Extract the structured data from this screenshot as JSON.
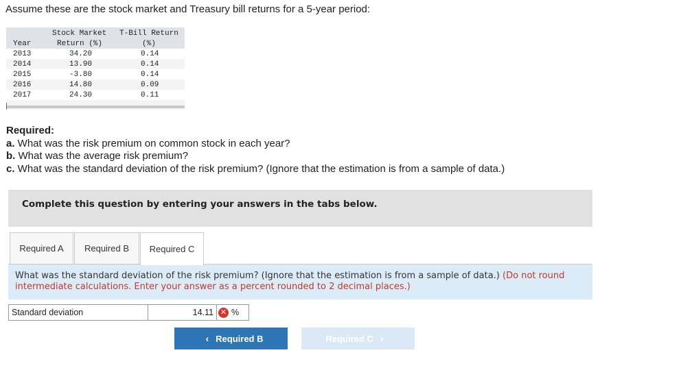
{
  "intro": "Assume these are the stock market and Treasury bill returns for a 5-year period:",
  "table": {
    "headers": {
      "year": "Year",
      "stock_line1": "Stock Market",
      "stock_line2": "Return (%)",
      "tbill_line1": "T-Bill Return",
      "tbill_line2": "(%)"
    },
    "rows": [
      {
        "year": "2013",
        "stock": "34.20",
        "tbill": "0.14"
      },
      {
        "year": "2014",
        "stock": "13.90",
        "tbill": "0.14"
      },
      {
        "year": "2015",
        "stock": "-3.80",
        "tbill": "0.14"
      },
      {
        "year": "2016",
        "stock": "14.80",
        "tbill": "0.09"
      },
      {
        "year": "2017",
        "stock": "24.30",
        "tbill": "0.11"
      }
    ]
  },
  "required": {
    "heading": "Required:",
    "a_prefix": "a.",
    "a_text": " What was the risk premium on common stock in each year?",
    "b_prefix": "b.",
    "b_text": " What was the average risk premium?",
    "c_prefix": "c.",
    "c_text": " What was the standard deviation of the risk premium? (Ignore that the estimation is from a sample of data.)"
  },
  "instruction": "Complete this question by entering your answers in the tabs below.",
  "tabs": [
    {
      "label": "Required A"
    },
    {
      "label": "Required B"
    },
    {
      "label": "Required C"
    }
  ],
  "question": {
    "text": "What was the standard deviation of the risk premium? (Ignore that the estimation is from a sample of data.)",
    "hint": "(Do not round intermediate calculations. Enter your answer as a percent rounded to 2 decimal places.)"
  },
  "answer": {
    "label": "Standard deviation",
    "value": "14.11",
    "status_icon": "x",
    "unit": "%"
  },
  "nav": {
    "prev_label": "Required B",
    "prev_icon": "‹",
    "next_label": "Required C",
    "next_icon": "›"
  },
  "colors": {
    "accent": "#2e75b6",
    "error": "#d9342b",
    "hint": "#c0392b",
    "question_bg": "#dcebf8"
  }
}
